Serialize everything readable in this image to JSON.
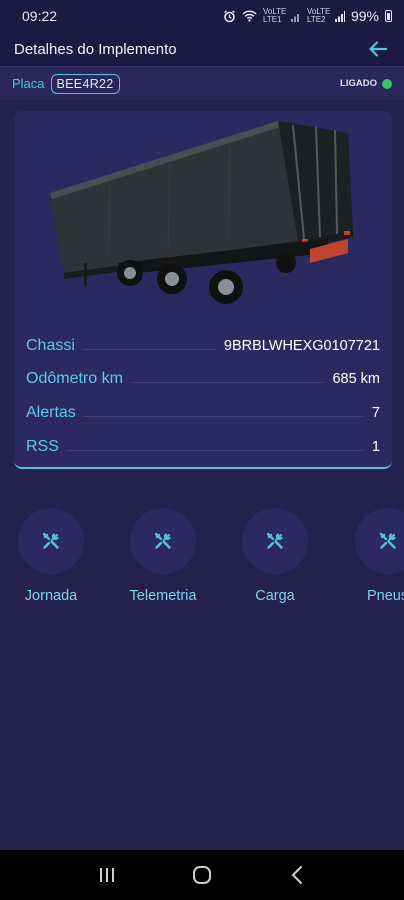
{
  "status_bar": {
    "time": "09:22",
    "signal_left": "VoLTE LTE1",
    "signal_right": "VoLTE LTE2",
    "battery": "99%"
  },
  "header": {
    "title": "Detalhes do Implemento",
    "back_icon": "arrow-left-icon"
  },
  "plate": {
    "label": "Placa",
    "value": "BEE4R22",
    "status": "LIGADO",
    "status_color": "#35c46a"
  },
  "details": [
    {
      "label": "Chassi",
      "value": "9BRBLWHEXG0107721"
    },
    {
      "label": "Odômetro km",
      "value": "685  km"
    },
    {
      "label": "Alertas",
      "value": "7"
    },
    {
      "label": "RSS",
      "value": "1"
    }
  ],
  "shortcuts": [
    {
      "label": "Jornada",
      "icon": "tools-icon"
    },
    {
      "label": "Telemetria",
      "icon": "tools-icon"
    },
    {
      "label": "Carga",
      "icon": "tools-icon"
    },
    {
      "label": "Pneus",
      "icon": "tools-icon"
    }
  ],
  "colors": {
    "accent": "#4fc3dc",
    "background": "#24214f",
    "card": "#2c2960"
  }
}
